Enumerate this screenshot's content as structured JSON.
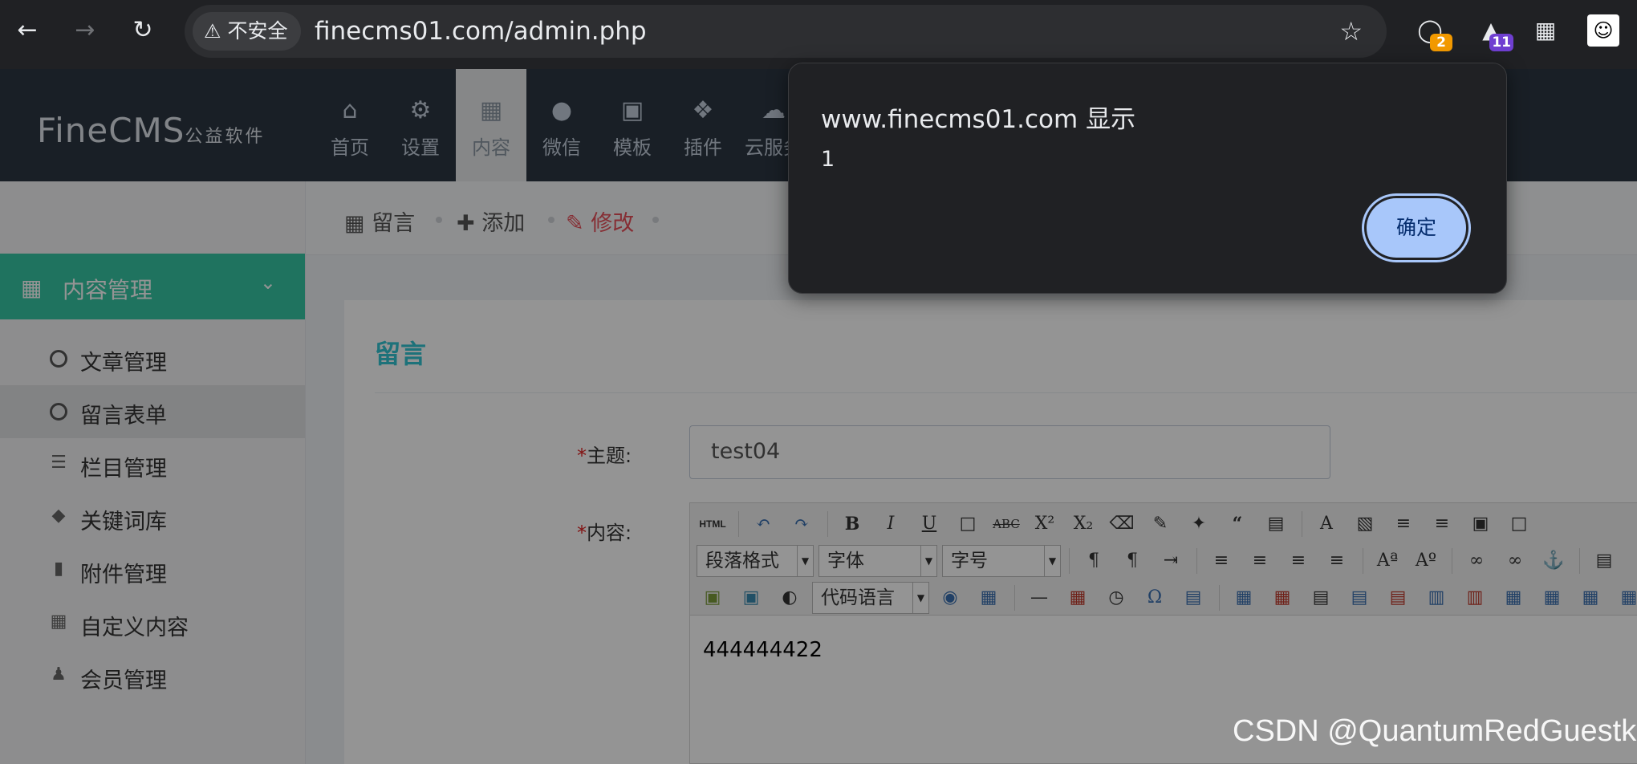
{
  "browser": {
    "security_label": "不安全",
    "url": "finecms01.com/admin.php",
    "extensions": [
      {
        "name": "extension-1",
        "badge": "2",
        "badge_color": "#f29900"
      },
      {
        "name": "extension-2",
        "badge": "11",
        "badge_color": "#6f3fd1"
      }
    ]
  },
  "header": {
    "logo_main": "FineCMS",
    "logo_sub": "公益软件",
    "nav": [
      {
        "label": "首页",
        "icon": "home-icon"
      },
      {
        "label": "设置",
        "icon": "gear-icon"
      },
      {
        "label": "内容",
        "icon": "grid-icon",
        "active": true
      },
      {
        "label": "微信",
        "icon": "wechat-icon"
      },
      {
        "label": "模板",
        "icon": "html5-icon"
      },
      {
        "label": "插件",
        "icon": "puzzle-icon"
      },
      {
        "label": "云服务",
        "icon": "cloud-icon"
      }
    ]
  },
  "sidebar": {
    "section": "内容管理",
    "items": [
      {
        "label": "文章管理",
        "icon": "circle-icon"
      },
      {
        "label": "留言表单",
        "icon": "circle-icon",
        "active": true
      },
      {
        "label": "栏目管理",
        "icon": "list-icon"
      },
      {
        "label": "关键词库",
        "icon": "tag-icon"
      },
      {
        "label": "附件管理",
        "icon": "folder-icon"
      },
      {
        "label": "自定义内容",
        "icon": "grid-icon"
      },
      {
        "label": "会员管理",
        "icon": "user-icon"
      }
    ]
  },
  "breadcrumb": {
    "items": [
      {
        "label": "留言",
        "icon": "table-icon"
      },
      {
        "label": "添加",
        "icon": "plus-icon"
      },
      {
        "label": "修改",
        "icon": "edit-icon",
        "active": true
      }
    ]
  },
  "panel": {
    "title": "留言",
    "subject_label": "主题:",
    "subject_value": "test04",
    "content_label": "内容:",
    "required_mark": "*",
    "editor": {
      "paragraph_format": "段落格式",
      "font_family": "字体",
      "font_size": "字号",
      "code_language": "代码语言",
      "html_button": "HTML",
      "body_text": "444444422"
    }
  },
  "alert": {
    "title": "www.finecms01.com 显示",
    "message": "1",
    "ok_label": "确定"
  },
  "watermark": "CSDN @QuantumRedGuestk",
  "colors": {
    "sidebar_accent": "#36c6a4",
    "panel_title": "#32c5d2",
    "header_bg": "#2b3643",
    "dialog_button": "#a8c7fa"
  }
}
